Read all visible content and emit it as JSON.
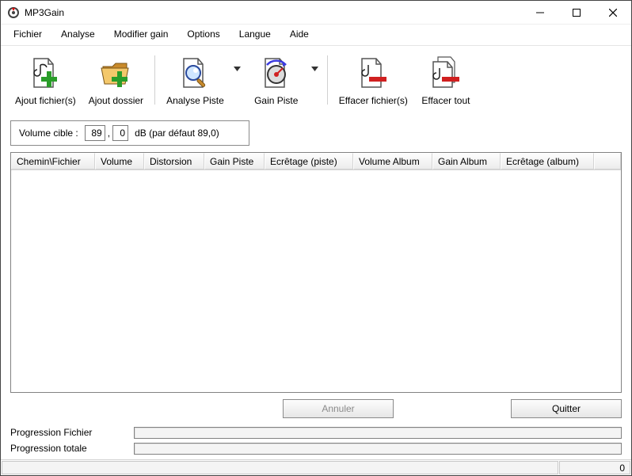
{
  "window": {
    "title": "MP3Gain"
  },
  "menu": {
    "items": [
      "Fichier",
      "Analyse",
      "Modifier gain",
      "Options",
      "Langue",
      "Aide"
    ]
  },
  "toolbar": {
    "add_files": "Ajout fichier(s)",
    "add_folder": "Ajout dossier",
    "analyze_track": "Analyse Piste",
    "gain_track": "Gain Piste",
    "delete_files": "Effacer fichier(s)",
    "delete_all": "Effacer tout"
  },
  "volume": {
    "label": "Volume cible :",
    "int": "89",
    "dec": "0",
    "unit_and_default": "dB  (par défaut 89,0)"
  },
  "columns": [
    "Chemin\\Fichier",
    "Volume",
    "Distorsion",
    "Gain Piste",
    "Ecrêtage (piste)",
    "Volume Album",
    "Gain Album",
    "Ecrêtage (album)"
  ],
  "rows": [],
  "buttons": {
    "cancel": "Annuler",
    "quit": "Quitter"
  },
  "progress": {
    "file_label": "Progression Fichier",
    "total_label": "Progression totale"
  },
  "status": {
    "count": "0"
  }
}
